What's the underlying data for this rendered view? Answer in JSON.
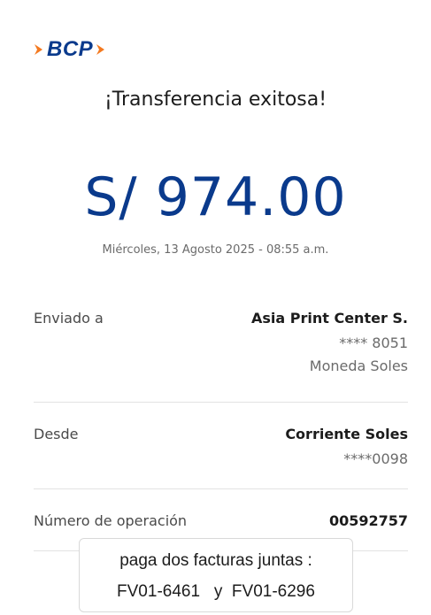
{
  "brand": {
    "logo_text": "BCP",
    "primary_color": "#0a3a8c",
    "accent_color": "#f47a20"
  },
  "header": {
    "title": "¡Transferencia exitosa!"
  },
  "transfer": {
    "amount": "S/ 974.00",
    "datetime": "Miércoles, 13 Agosto 2025 - 08:55 a.m."
  },
  "details": {
    "sent_to": {
      "label": "Enviado a",
      "name": "Asia Print Center S.",
      "account": "**** 8051",
      "currency": "Moneda Soles"
    },
    "from": {
      "label": "Desde",
      "account_type": "Corriente Soles",
      "account": "****0098"
    },
    "operation": {
      "label": "Número de operación",
      "number": "00592757"
    }
  },
  "note": {
    "line1": "paga dos facturas juntas :",
    "line2": "FV01-6461   y  FV01-6296"
  }
}
